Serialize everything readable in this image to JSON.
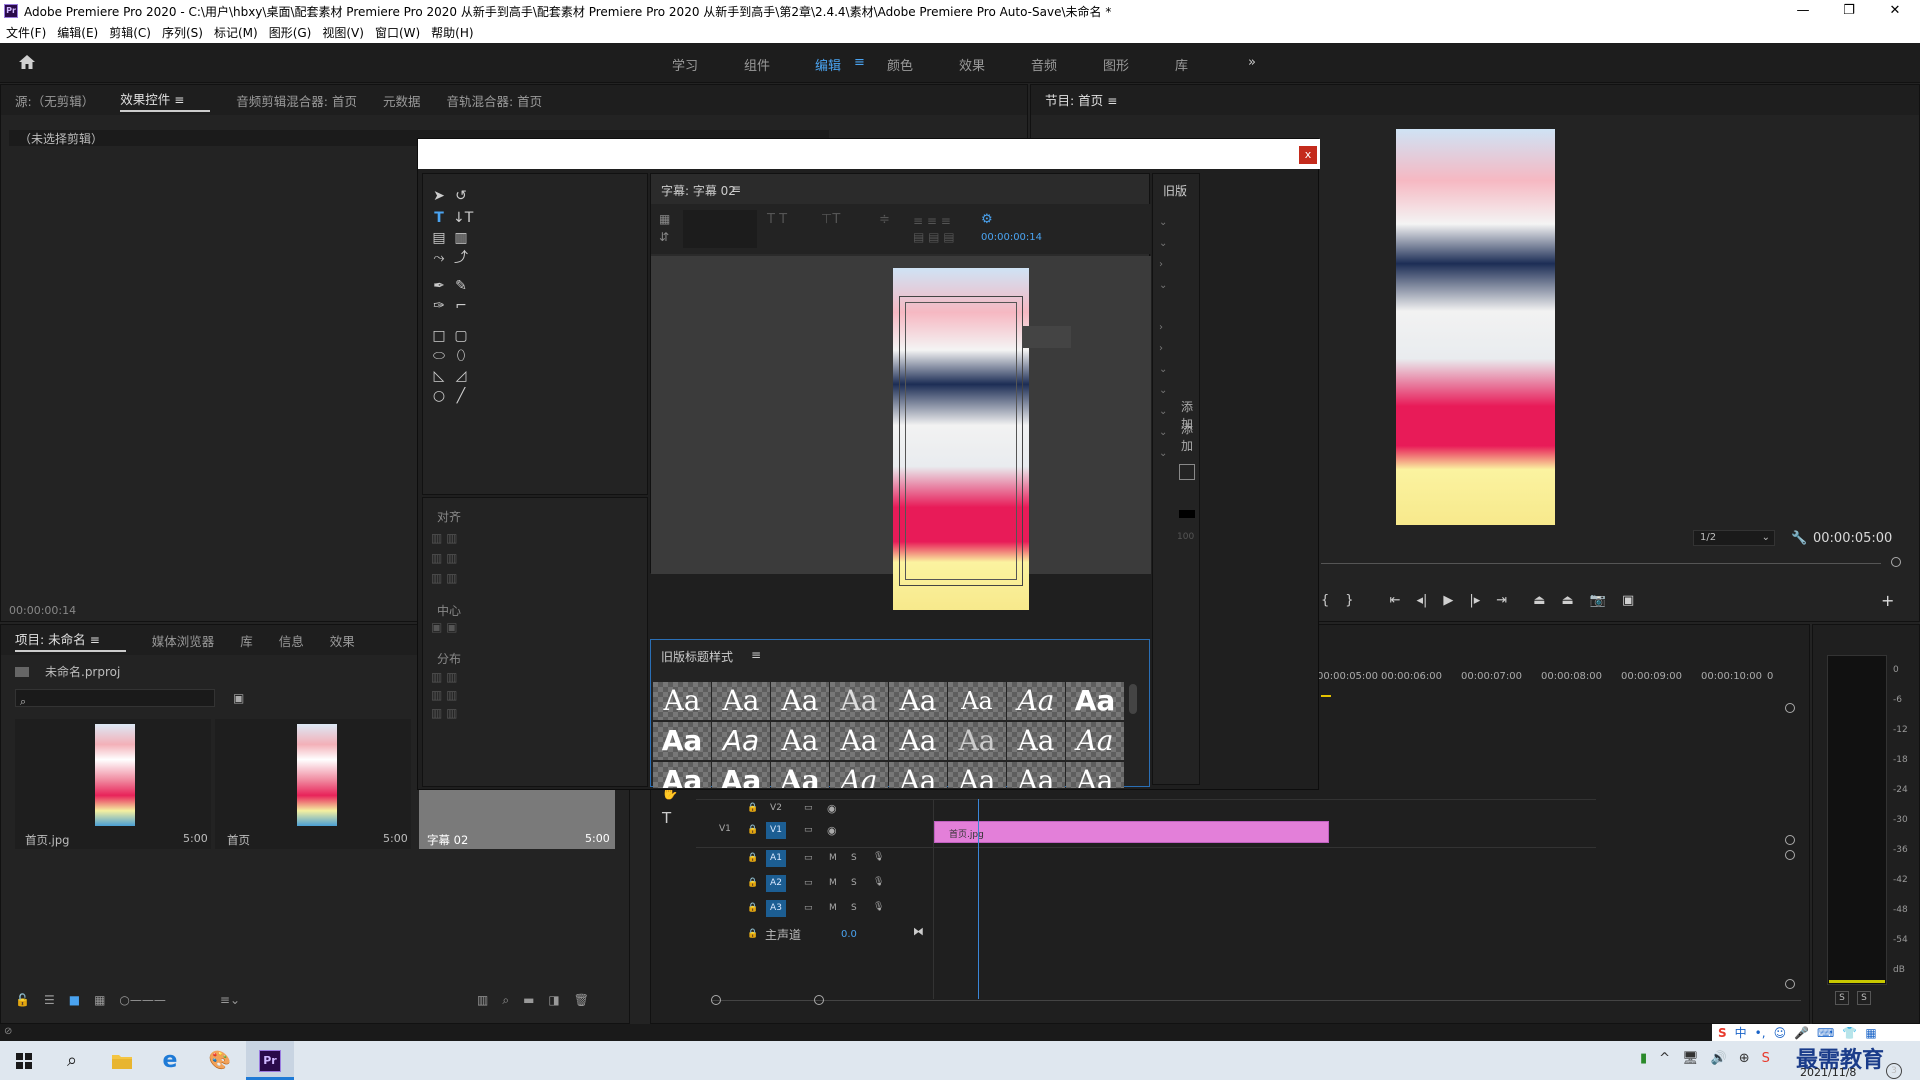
{
  "titlebar": {
    "app_icon": "Pr",
    "title": "Adobe Premiere Pro 2020 - C:\\用户\\hbxy\\桌面\\配套素材 Premiere Pro 2020 从新手到高手\\配套素材 Premiere Pro 2020 从新手到高手\\第2章\\2.4.4\\素材\\Adobe Premiere Pro Auto-Save\\未命名 *"
  },
  "menubar": [
    "文件(F)",
    "编辑(E)",
    "剪辑(C)",
    "序列(S)",
    "标记(M)",
    "图形(G)",
    "视图(V)",
    "窗口(W)",
    "帮助(H)"
  ],
  "workspaces": {
    "items": [
      "学习",
      "组件",
      "编辑",
      "颜色",
      "效果",
      "音频",
      "图形",
      "库"
    ],
    "active": "编辑",
    "more": "»"
  },
  "source_panel": {
    "tabs": [
      "源:（无剪辑）",
      "效果控件",
      "音频剪辑混合器: 首页",
      "元数据",
      "音轨混合器: 首页"
    ],
    "active": "效果控件",
    "no_clip": "（未选择剪辑）",
    "timecode": "00:00:00:14"
  },
  "program_panel": {
    "title": "节目: 首页",
    "zoom": "1/2",
    "timecode": "00:00:05:00"
  },
  "project_panel": {
    "tabs": [
      "项目: 未命名",
      "媒体浏览器",
      "库",
      "信息",
      "效果"
    ],
    "active": "项目: 未命名",
    "file": "未命名.prproj",
    "items": [
      {
        "name": "首页.jpg",
        "dur": "5:00"
      },
      {
        "name": "首页",
        "dur": "5:00"
      },
      {
        "name": "字幕 02",
        "dur": "5:00"
      }
    ]
  },
  "title_dialog": {
    "close": "x",
    "caption_title": "字幕: 字幕 02",
    "timecode": "00:00:00:14",
    "right_header": "旧版",
    "align_label": "对齐",
    "center_label": "中心",
    "distribute_label": "分布",
    "styles_title": "旧版标题样式",
    "style_sample": "Aa",
    "right_labels": [
      "添加",
      "添加"
    ],
    "right_value": "100"
  },
  "timeline": {
    "ruler": [
      "00:00:05:00",
      "00:00:06:00",
      "00:00:07:00",
      "00:00:08:00",
      "00:00:09:00",
      "00:00:10:00",
      "0"
    ],
    "tracks": [
      "V2",
      "V1",
      "A1",
      "A2",
      "A3"
    ],
    "m": "M",
    "s": "S",
    "master_label": "主声道",
    "master_value": "0.0",
    "clip_name": "首页.jpg",
    "v1_side": "V1"
  },
  "meter": {
    "scale": [
      "0",
      "-6",
      "-12",
      "-18",
      "-24",
      "-30",
      "-36",
      "-42",
      "-48",
      "-54",
      "dB"
    ],
    "solo": [
      "S",
      "S"
    ]
  },
  "taskbar": {
    "ime": "中",
    "date": "2021/11/8",
    "watermark": "最需教育"
  }
}
